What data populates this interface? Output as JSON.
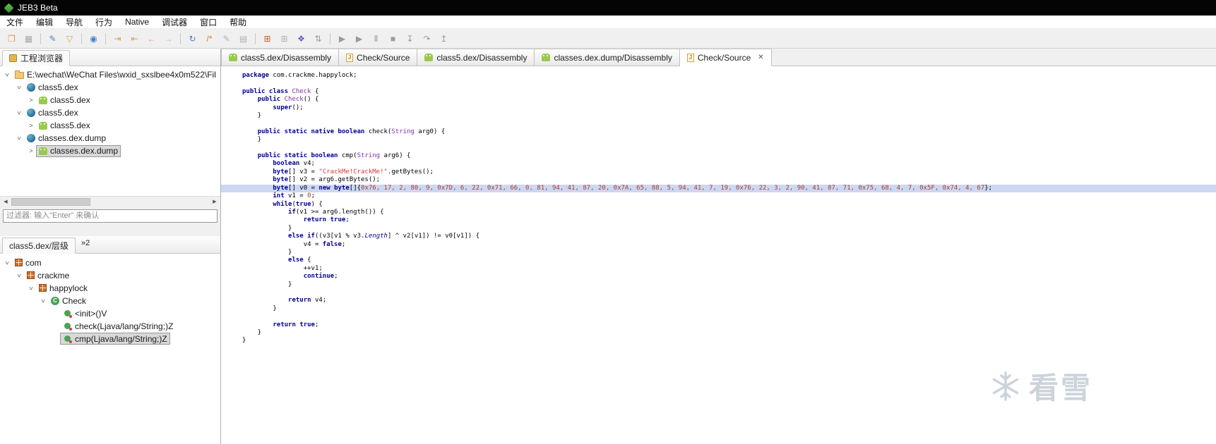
{
  "window": {
    "title": "JEB3 Beta",
    "accent": "#3aa13a"
  },
  "menubar": {
    "items": [
      "文件",
      "编辑",
      "导航",
      "行为",
      "Native",
      "调试器",
      "窗口",
      "帮助"
    ]
  },
  "toolbar": {
    "groups": [
      [
        {
          "name": "open-icon",
          "glyph": "❐",
          "color": "#d99c3f"
        },
        {
          "name": "save-icon",
          "glyph": "▦",
          "color": "#a9a9a9"
        }
      ],
      [
        {
          "name": "brush-icon",
          "glyph": "✎",
          "color": "#4a7fd0"
        },
        {
          "name": "flask-icon",
          "glyph": "▽",
          "color": "#e0a33e"
        }
      ],
      [
        {
          "name": "globe-icon",
          "glyph": "◉",
          "color": "#3f7fd0"
        }
      ],
      [
        {
          "name": "jump-into-icon",
          "glyph": "⇥",
          "color": "#e0a33e"
        },
        {
          "name": "jump-back-icon",
          "glyph": "⇤",
          "color": "#e0a33e"
        },
        {
          "name": "nav-back-icon",
          "glyph": "←",
          "color": "#e0a33e"
        },
        {
          "name": "nav-forward-icon",
          "glyph": "→",
          "color": "#bdbdbd"
        }
      ],
      [
        {
          "name": "refresh-icon",
          "glyph": "↻",
          "color": "#4a7fd0"
        },
        {
          "name": "comment-icon",
          "glyph": "/*",
          "color": "#d08030"
        },
        {
          "name": "rename-icon",
          "glyph": "✎",
          "color": "#b0b0b0"
        },
        {
          "name": "copy-icon",
          "glyph": "▤",
          "color": "#b0b0b0"
        }
      ],
      [
        {
          "name": "table-icon",
          "glyph": "⊞",
          "color": "#c06030"
        },
        {
          "name": "memory-icon",
          "glyph": "⊞",
          "color": "#b0b0b0"
        },
        {
          "name": "types-icon",
          "glyph": "❖",
          "color": "#7a52c0"
        },
        {
          "name": "sort-icon",
          "glyph": "⇅",
          "color": "#9a9a9a"
        }
      ],
      [
        {
          "name": "debug-start-icon",
          "glyph": "▶",
          "color": "#9a9a9a"
        },
        {
          "name": "debug-run-icon",
          "glyph": "▶",
          "color": "#9a9a9a"
        },
        {
          "name": "debug-pause-icon",
          "glyph": "Ⅱ",
          "color": "#9a9a9a"
        },
        {
          "name": "debug-stop-icon",
          "glyph": "■",
          "color": "#9a9a9a"
        },
        {
          "name": "step-into-icon",
          "glyph": "↧",
          "color": "#9a9a9a"
        },
        {
          "name": "step-over-icon",
          "glyph": "↷",
          "color": "#9a9a9a"
        },
        {
          "name": "step-out-icon",
          "glyph": "↥",
          "color": "#9a9a9a"
        }
      ]
    ]
  },
  "project_browser": {
    "tab_label": "工程浏览器",
    "filter_placeholder": "过滤器: 输入\"Enter\" 来确认",
    "scroll_left_glyph": "◀",
    "scroll_right_glyph": "▶",
    "tree": [
      {
        "depth": 0,
        "exp": "open",
        "icon": "folder",
        "label": "E:\\wechat\\WeChat Files\\wxid_sxslbee4x0m522\\Fil"
      },
      {
        "depth": 1,
        "exp": "open",
        "icon": "dex",
        "label": "class5.dex"
      },
      {
        "depth": 2,
        "exp": "closed",
        "icon": "android",
        "label": "class5.dex"
      },
      {
        "depth": 1,
        "exp": "open",
        "icon": "dex",
        "label": "class5.dex"
      },
      {
        "depth": 2,
        "exp": "closed",
        "icon": "android",
        "label": "class5.dex"
      },
      {
        "depth": 1,
        "exp": "open",
        "icon": "dex",
        "label": "classes.dex.dump"
      },
      {
        "depth": 2,
        "exp": "closed",
        "icon": "android",
        "label": "classes.dex.dump",
        "selected": true
      }
    ]
  },
  "hierarchy": {
    "tab_label": "class5.dex/层级",
    "overflow_badge": "»2",
    "tree": [
      {
        "depth": 0,
        "exp": "open",
        "icon": "package",
        "label": "com"
      },
      {
        "depth": 1,
        "exp": "open",
        "icon": "package",
        "label": "crackme"
      },
      {
        "depth": 2,
        "exp": "open",
        "icon": "package",
        "label": "happylock"
      },
      {
        "depth": 3,
        "exp": "open",
        "icon": "class",
        "label": "Check"
      },
      {
        "depth": 4,
        "exp": "none",
        "icon": "method",
        "label": "<init>()V"
      },
      {
        "depth": 4,
        "exp": "none",
        "icon": "method",
        "label": "check(Ljava/lang/String;)Z"
      },
      {
        "depth": 4,
        "exp": "none",
        "icon": "method",
        "label": "cmp(Ljava/lang/String;)Z",
        "selected": true
      }
    ]
  },
  "editor": {
    "tabs": [
      {
        "label": "class5.dex/Disassembly",
        "icon": "android",
        "active": false
      },
      {
        "label": "Check/Source",
        "icon": "java",
        "active": false
      },
      {
        "label": "class5.dex/Disassembly",
        "icon": "android",
        "active": false
      },
      {
        "label": "classes.dex.dump/Disassembly",
        "icon": "android",
        "active": false
      },
      {
        "label": "Check/Source",
        "icon": "java",
        "active": true,
        "close": "✕"
      }
    ],
    "code": {
      "highlight_index": 14,
      "lines": [
        [
          [
            "package",
            "k"
          ],
          [
            " com.crackme.happylock;",
            "p"
          ]
        ],
        [],
        [
          [
            "public class ",
            "k"
          ],
          [
            "Check",
            "t"
          ],
          [
            " {",
            "p"
          ]
        ],
        [
          [
            "    ",
            "p"
          ],
          [
            "public ",
            "k"
          ],
          [
            "Check",
            "t"
          ],
          [
            "() {",
            "p"
          ]
        ],
        [
          [
            "        ",
            "p"
          ],
          [
            "super",
            "k"
          ],
          [
            "();",
            "p"
          ]
        ],
        [
          [
            "    }",
            "p"
          ]
        ],
        [],
        [
          [
            "    ",
            "p"
          ],
          [
            "public static native boolean ",
            "k"
          ],
          [
            "check(",
            "p"
          ],
          [
            "String",
            "t"
          ],
          [
            " arg0) {",
            "p"
          ]
        ],
        [
          [
            "    }",
            "p"
          ]
        ],
        [],
        [
          [
            "    ",
            "p"
          ],
          [
            "public static boolean ",
            "k"
          ],
          [
            "cmp(",
            "p"
          ],
          [
            "String",
            "t"
          ],
          [
            " arg6) {",
            "p"
          ]
        ],
        [
          [
            "        ",
            "p"
          ],
          [
            "boolean",
            "k"
          ],
          [
            " v4;",
            "p"
          ]
        ],
        [
          [
            "        ",
            "p"
          ],
          [
            "byte",
            "k"
          ],
          [
            "[] v3 = ",
            "p"
          ],
          [
            "\"CrackMe!CrackMe!\"",
            "s"
          ],
          [
            ".getBytes();",
            "p"
          ]
        ],
        [
          [
            "        ",
            "p"
          ],
          [
            "byte",
            "k"
          ],
          [
            "[] v2 = arg6.getBytes();",
            "p"
          ]
        ],
        [
          [
            "        ",
            "p"
          ],
          [
            "byte",
            "k"
          ],
          [
            "[] v0 = ",
            "p"
          ],
          [
            "new",
            "k"
          ],
          [
            " ",
            "p"
          ],
          [
            "byte",
            "k"
          ],
          [
            "[]{",
            "p"
          ],
          [
            "0x76, 17, 2, 80, 9, 0x7D, 6, 22, 0x71, 66, 0, 81, 94, 41, 87, 20, 0x7A, 65, 88, 5, 94, 41, 7, 19, 0x76, 22, 3, 2, 90, 41, 87, 71, 0x75, 68, 4, 7, 0x5F, 0x74, 4, 67",
            "n"
          ],
          [
            "};",
            "p"
          ]
        ],
        [
          [
            "        ",
            "p"
          ],
          [
            "int",
            "k"
          ],
          [
            " v1 = ",
            "p"
          ],
          [
            "0",
            "n"
          ],
          [
            ";",
            "p"
          ]
        ],
        [
          [
            "        ",
            "p"
          ],
          [
            "while",
            "k"
          ],
          [
            "(",
            "p"
          ],
          [
            "true",
            "k"
          ],
          [
            ") {",
            "p"
          ]
        ],
        [
          [
            "            ",
            "p"
          ],
          [
            "if",
            "k"
          ],
          [
            "(v1 >= arg6.length()) {",
            "p"
          ]
        ],
        [
          [
            "                ",
            "p"
          ],
          [
            "return",
            "k"
          ],
          [
            " ",
            "p"
          ],
          [
            "true",
            "k"
          ],
          [
            ";",
            "p"
          ]
        ],
        [
          [
            "            }",
            "p"
          ]
        ],
        [
          [
            "            ",
            "p"
          ],
          [
            "else",
            "k"
          ],
          [
            " ",
            "p"
          ],
          [
            "if",
            "k"
          ],
          [
            "((v3[v1 % v3.",
            "p"
          ],
          [
            "Length",
            "i"
          ],
          [
            "] ^ v2[v1]) != v0[v1]) {",
            "p"
          ]
        ],
        [
          [
            "                v4 = ",
            "p"
          ],
          [
            "false",
            "k"
          ],
          [
            ";",
            "p"
          ]
        ],
        [
          [
            "            }",
            "p"
          ]
        ],
        [
          [
            "            ",
            "p"
          ],
          [
            "else",
            "k"
          ],
          [
            " {",
            "p"
          ]
        ],
        [
          [
            "                ++v1;",
            "p"
          ]
        ],
        [
          [
            "                ",
            "p"
          ],
          [
            "continue",
            "k"
          ],
          [
            ";",
            "p"
          ]
        ],
        [
          [
            "            }",
            "p"
          ]
        ],
        [],
        [
          [
            "            ",
            "p"
          ],
          [
            "return",
            "k"
          ],
          [
            " v4;",
            "p"
          ]
        ],
        [
          [
            "        }",
            "p"
          ]
        ],
        [],
        [
          [
            "        ",
            "p"
          ],
          [
            "return",
            "k"
          ],
          [
            " ",
            "p"
          ],
          [
            "true",
            "k"
          ],
          [
            ";",
            "p"
          ]
        ],
        [
          [
            "    }",
            "p"
          ]
        ],
        [
          [
            "}",
            "p"
          ]
        ]
      ]
    }
  },
  "watermark": {
    "text": "看雪"
  },
  "colors": {
    "keyword": "#00008f",
    "type": "#8231a8",
    "string": "#d53a36",
    "number": "#b03a32",
    "highlight_line": "#ccd8f2",
    "titlebar": "#040404",
    "selection": "#d9d9d9"
  }
}
